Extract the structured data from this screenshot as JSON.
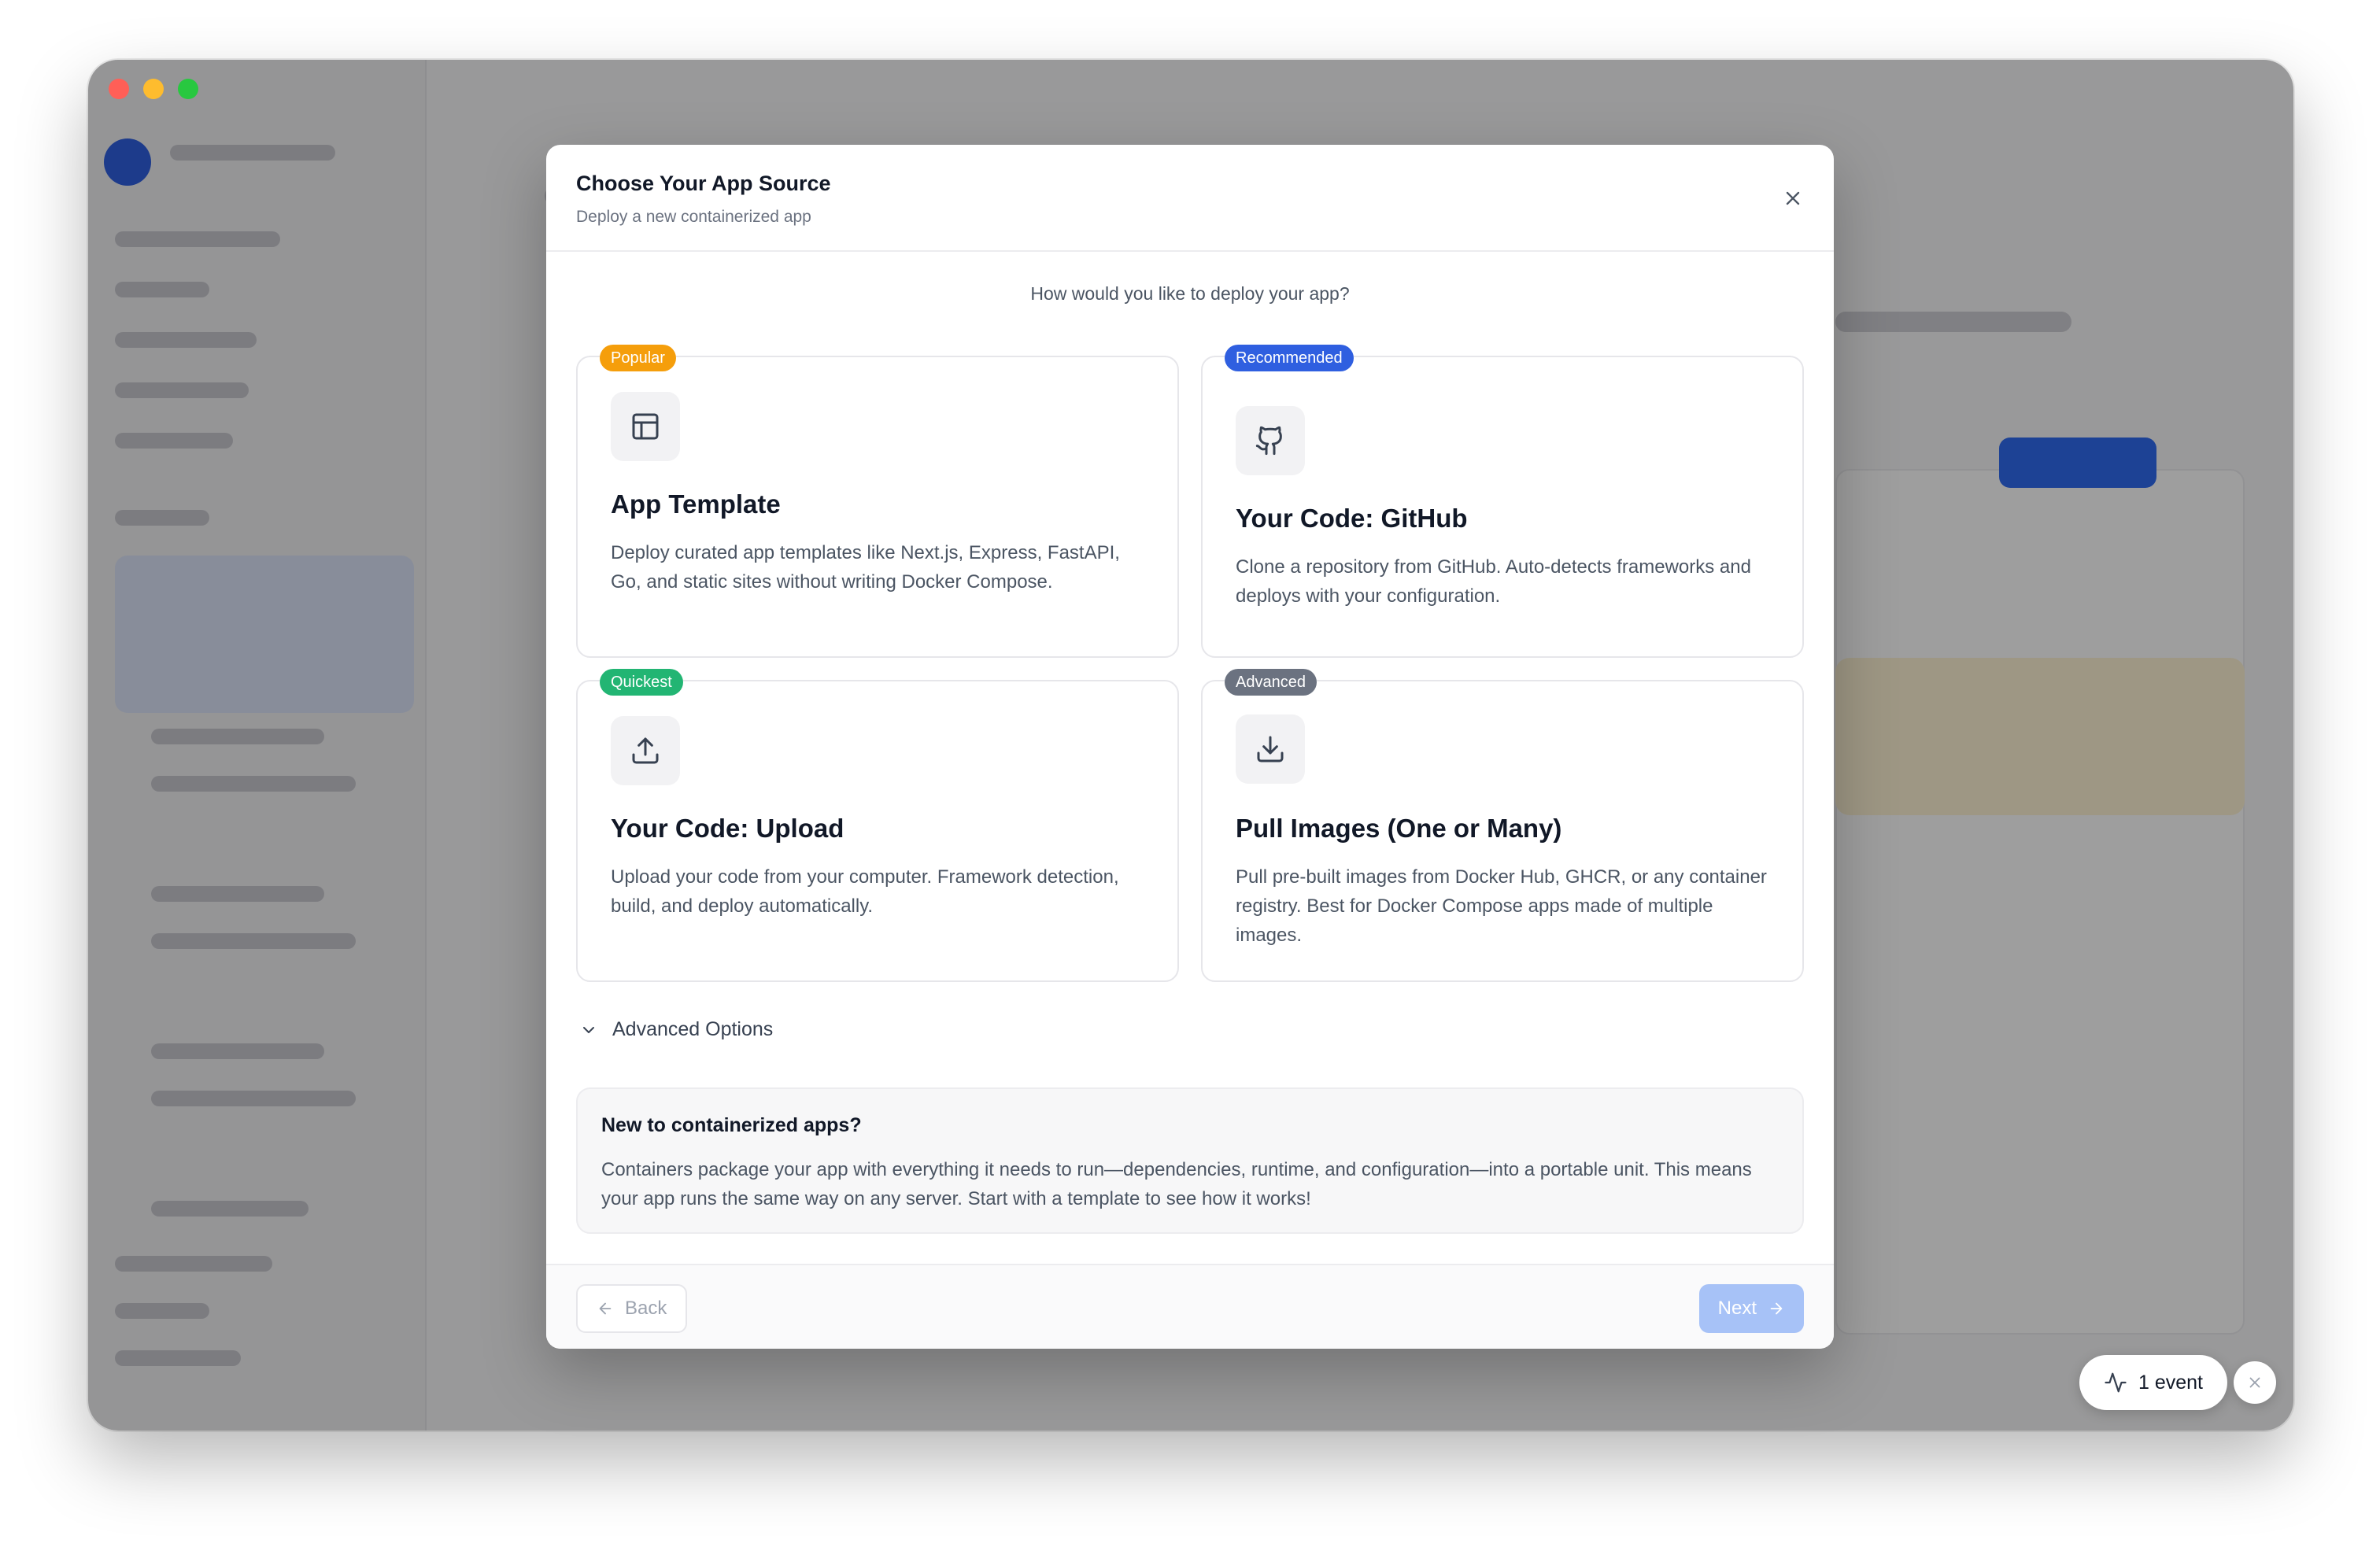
{
  "modal": {
    "title": "Choose Your App Source",
    "subtitle": "Deploy a new containerized app",
    "question": "How would you like to deploy your app?",
    "options": [
      {
        "badge": "Popular",
        "badge_color": "#f59e0b",
        "icon": "layout-template-icon",
        "title": "App Template",
        "description": "Deploy curated app templates like Next.js, Express, FastAPI, Go, and static sites without writing Docker Compose."
      },
      {
        "badge": "Recommended",
        "badge_color": "#2f5fe0",
        "icon": "github-icon",
        "title": "Your Code: GitHub",
        "description": "Clone a repository from GitHub. Auto-detects frameworks and deploys with your configuration."
      },
      {
        "badge": "Quickest",
        "badge_color": "#22b573",
        "icon": "upload-icon",
        "title": "Your Code: Upload",
        "description": "Upload your code from your computer. Framework detection, build, and deploy automatically."
      },
      {
        "badge": "Advanced",
        "badge_color": "#6b7280",
        "icon": "download-icon",
        "title": "Pull Images (One or Many)",
        "description": "Pull pre-built images from Docker Hub, GHCR, or any container registry. Best for Docker Compose apps made of multiple images."
      }
    ],
    "advanced_options_label": "Advanced Options",
    "info": {
      "title": "New to containerized apps?",
      "text": "Containers package your app with everything it needs to run—dependencies, runtime, and configuration—into a portable unit. This means your app runs the same way on any server. Start with a template to see how it works!"
    },
    "footer": {
      "back_label": "Back",
      "next_label": "Next"
    }
  },
  "event_indicator": {
    "label": "1 event",
    "icon": "activity-icon"
  },
  "colors": {
    "accent": "#2f5fe0",
    "next_disabled": "#a7c2f7"
  }
}
